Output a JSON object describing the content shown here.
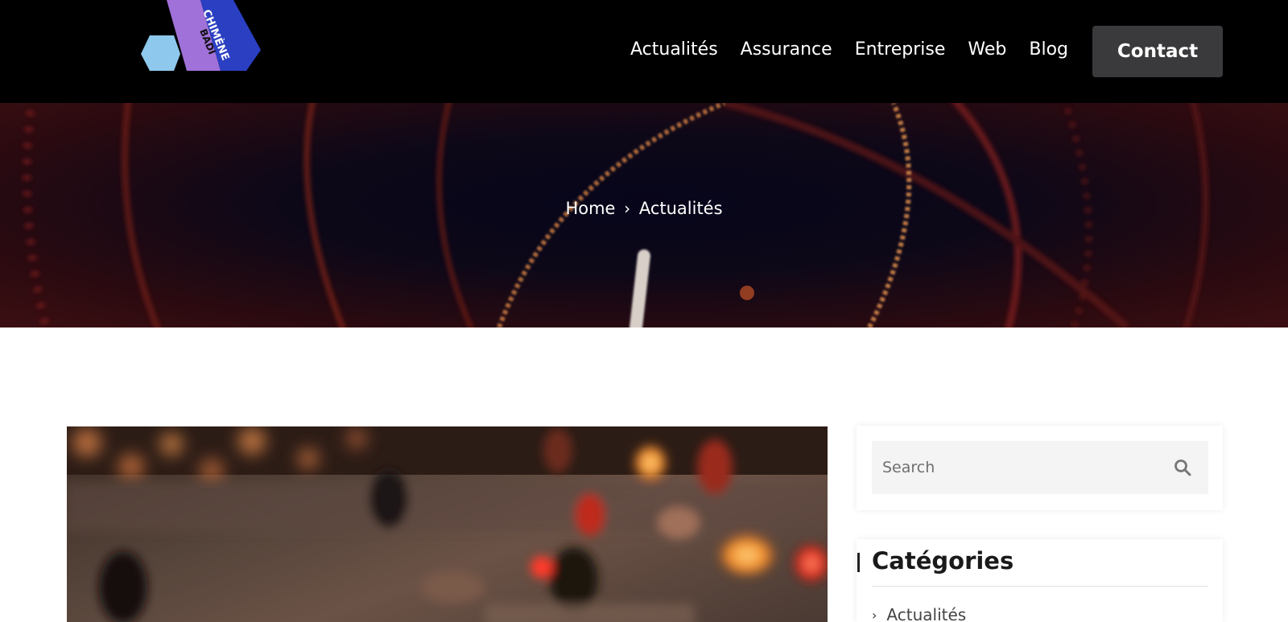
{
  "header": {
    "logo_text_lines": [
      "CHIMÈNE",
      "BADI"
    ],
    "nav": [
      "Actualités",
      "Assurance",
      "Entreprise",
      "Web",
      "Blog"
    ],
    "contact_label": "Contact"
  },
  "hero": {
    "breadcrumb_home": "Home",
    "breadcrumb_separator_icon": "chevron-right-icon",
    "breadcrumb_current": "Actualités"
  },
  "sidebar": {
    "search_placeholder": "Search",
    "search_icon": "search-icon",
    "categories_title": "Catégories",
    "categories": [
      "Actualités"
    ]
  },
  "colors": {
    "header_bg": "#000000",
    "contact_button_bg": "#3a3a3c",
    "logo_light_blue": "#8ec8ec",
    "logo_purple": "#a071d8",
    "logo_blue": "#2a3fc2"
  }
}
